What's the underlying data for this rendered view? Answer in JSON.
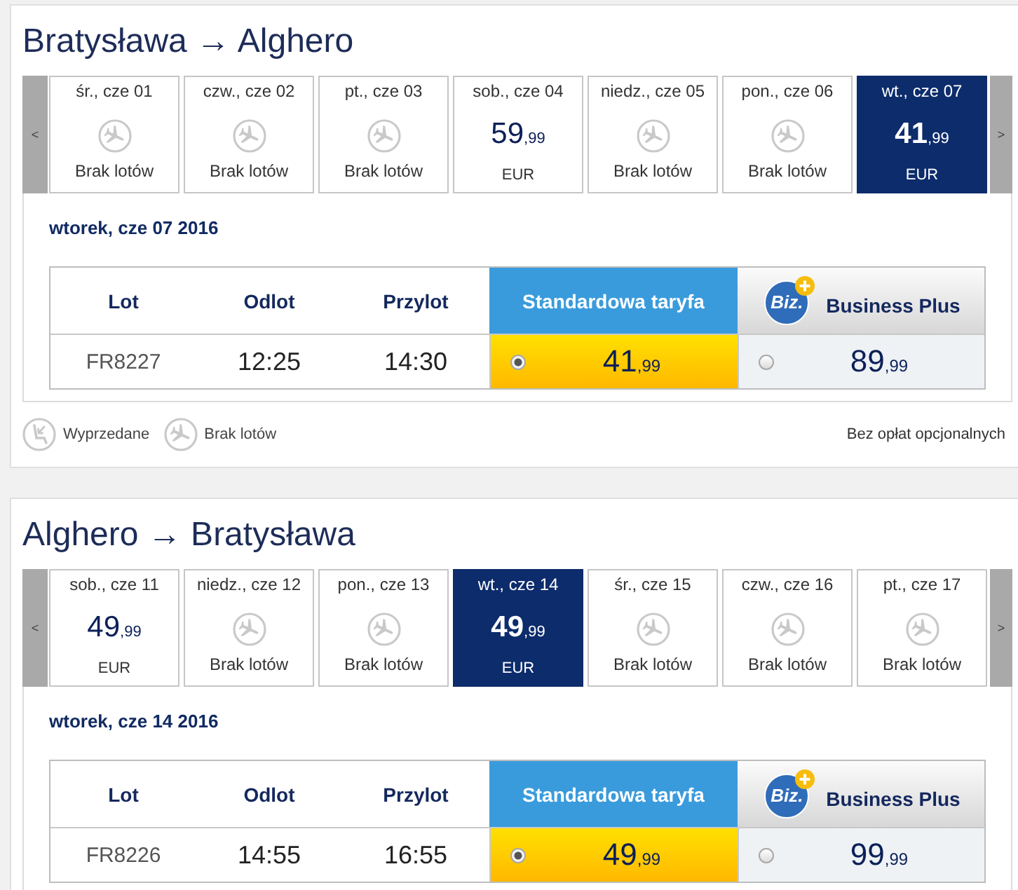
{
  "legs": [
    {
      "title": "Bratysława → Alghero",
      "prev_label": "<",
      "next_label": ">",
      "dates": [
        {
          "day": "śr., cze 01",
          "kind": "no_flights",
          "label": "Brak lotów",
          "selected": false
        },
        {
          "day": "czw., cze 02",
          "kind": "no_flights",
          "label": "Brak lotów",
          "selected": false
        },
        {
          "day": "pt., cze 03",
          "kind": "no_flights",
          "label": "Brak lotów",
          "selected": false
        },
        {
          "day": "sob., cze 04",
          "kind": "price",
          "amount": "59",
          "cents": ",99",
          "currency": "EUR",
          "selected": false
        },
        {
          "day": "niedz., cze 05",
          "kind": "no_flights",
          "label": "Brak lotów",
          "selected": false
        },
        {
          "day": "pon., cze 06",
          "kind": "no_flights",
          "label": "Brak lotów",
          "selected": false
        },
        {
          "day": "wt., cze 07",
          "kind": "price",
          "amount": "41",
          "cents": ",99",
          "currency": "EUR",
          "selected": true
        }
      ],
      "date_heading": "wtorek, cze 07 2016",
      "table": {
        "columns": [
          "Lot",
          "Odlot",
          "Przylot"
        ],
        "fare_columns": [
          {
            "kind": "standard",
            "label": "Standardowa taryfa"
          },
          {
            "kind": "business",
            "label": "Business Plus",
            "logo": "Biz."
          }
        ],
        "rows": [
          {
            "flight": "FR8227",
            "departure": "12:25",
            "arrival": "14:30",
            "fares": [
              {
                "amount": "41",
                "cents": ",99",
                "selected": true
              },
              {
                "amount": "89",
                "cents": ",99",
                "selected": false
              }
            ]
          }
        ]
      },
      "legend": {
        "items": [
          {
            "kind": "sold_out",
            "label": "Wyprzedane"
          },
          {
            "kind": "no_flights",
            "label": "Brak lotów"
          }
        ],
        "note": "Bez opłat opcjonalnych"
      }
    },
    {
      "title": "Alghero → Bratysława",
      "prev_label": "<",
      "next_label": ">",
      "dates": [
        {
          "day": "sob., cze 11",
          "kind": "price",
          "amount": "49",
          "cents": ",99",
          "currency": "EUR",
          "selected": false
        },
        {
          "day": "niedz., cze 12",
          "kind": "no_flights",
          "label": "Brak lotów",
          "selected": false
        },
        {
          "day": "pon., cze 13",
          "kind": "no_flights",
          "label": "Brak lotów",
          "selected": false
        },
        {
          "day": "wt., cze 14",
          "kind": "price",
          "amount": "49",
          "cents": ",99",
          "currency": "EUR",
          "selected": true
        },
        {
          "day": "śr., cze 15",
          "kind": "no_flights",
          "label": "Brak lotów",
          "selected": false
        },
        {
          "day": "czw., cze 16",
          "kind": "no_flights",
          "label": "Brak lotów",
          "selected": false
        },
        {
          "day": "pt., cze 17",
          "kind": "no_flights",
          "label": "Brak lotów",
          "selected": false
        }
      ],
      "date_heading": "wtorek, cze 14 2016",
      "table": {
        "columns": [
          "Lot",
          "Odlot",
          "Przylot"
        ],
        "fare_columns": [
          {
            "kind": "standard",
            "label": "Standardowa taryfa"
          },
          {
            "kind": "business",
            "label": "Business Plus",
            "logo": "Biz."
          }
        ],
        "rows": [
          {
            "flight": "FR8226",
            "departure": "14:55",
            "arrival": "16:55",
            "fares": [
              {
                "amount": "49",
                "cents": ",99",
                "selected": true
              },
              {
                "amount": "99",
                "cents": ",99",
                "selected": false
              }
            ]
          }
        ]
      }
    }
  ]
}
